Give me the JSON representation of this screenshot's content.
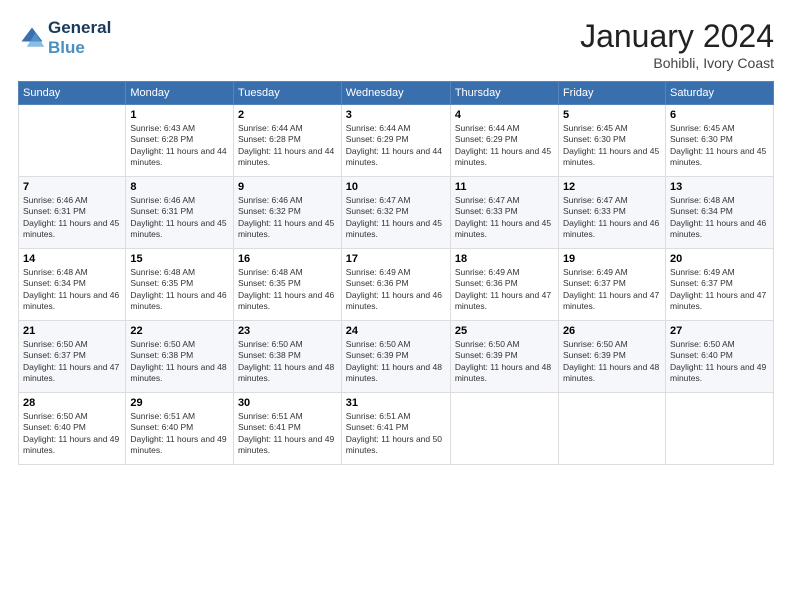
{
  "header": {
    "logo_line1": "General",
    "logo_line2": "Blue",
    "month_title": "January 2024",
    "subtitle": "Bohibli, Ivory Coast"
  },
  "weekdays": [
    "Sunday",
    "Monday",
    "Tuesday",
    "Wednesday",
    "Thursday",
    "Friday",
    "Saturday"
  ],
  "weeks": [
    [
      {
        "day": "",
        "sunrise": "",
        "sunset": "",
        "daylight": ""
      },
      {
        "day": "1",
        "sunrise": "Sunrise: 6:43 AM",
        "sunset": "Sunset: 6:28 PM",
        "daylight": "Daylight: 11 hours and 44 minutes."
      },
      {
        "day": "2",
        "sunrise": "Sunrise: 6:44 AM",
        "sunset": "Sunset: 6:28 PM",
        "daylight": "Daylight: 11 hours and 44 minutes."
      },
      {
        "day": "3",
        "sunrise": "Sunrise: 6:44 AM",
        "sunset": "Sunset: 6:29 PM",
        "daylight": "Daylight: 11 hours and 44 minutes."
      },
      {
        "day": "4",
        "sunrise": "Sunrise: 6:44 AM",
        "sunset": "Sunset: 6:29 PM",
        "daylight": "Daylight: 11 hours and 45 minutes."
      },
      {
        "day": "5",
        "sunrise": "Sunrise: 6:45 AM",
        "sunset": "Sunset: 6:30 PM",
        "daylight": "Daylight: 11 hours and 45 minutes."
      },
      {
        "day": "6",
        "sunrise": "Sunrise: 6:45 AM",
        "sunset": "Sunset: 6:30 PM",
        "daylight": "Daylight: 11 hours and 45 minutes."
      }
    ],
    [
      {
        "day": "7",
        "sunrise": "Sunrise: 6:46 AM",
        "sunset": "Sunset: 6:31 PM",
        "daylight": "Daylight: 11 hours and 45 minutes."
      },
      {
        "day": "8",
        "sunrise": "Sunrise: 6:46 AM",
        "sunset": "Sunset: 6:31 PM",
        "daylight": "Daylight: 11 hours and 45 minutes."
      },
      {
        "day": "9",
        "sunrise": "Sunrise: 6:46 AM",
        "sunset": "Sunset: 6:32 PM",
        "daylight": "Daylight: 11 hours and 45 minutes."
      },
      {
        "day": "10",
        "sunrise": "Sunrise: 6:47 AM",
        "sunset": "Sunset: 6:32 PM",
        "daylight": "Daylight: 11 hours and 45 minutes."
      },
      {
        "day": "11",
        "sunrise": "Sunrise: 6:47 AM",
        "sunset": "Sunset: 6:33 PM",
        "daylight": "Daylight: 11 hours and 45 minutes."
      },
      {
        "day": "12",
        "sunrise": "Sunrise: 6:47 AM",
        "sunset": "Sunset: 6:33 PM",
        "daylight": "Daylight: 11 hours and 46 minutes."
      },
      {
        "day": "13",
        "sunrise": "Sunrise: 6:48 AM",
        "sunset": "Sunset: 6:34 PM",
        "daylight": "Daylight: 11 hours and 46 minutes."
      }
    ],
    [
      {
        "day": "14",
        "sunrise": "Sunrise: 6:48 AM",
        "sunset": "Sunset: 6:34 PM",
        "daylight": "Daylight: 11 hours and 46 minutes."
      },
      {
        "day": "15",
        "sunrise": "Sunrise: 6:48 AM",
        "sunset": "Sunset: 6:35 PM",
        "daylight": "Daylight: 11 hours and 46 minutes."
      },
      {
        "day": "16",
        "sunrise": "Sunrise: 6:48 AM",
        "sunset": "Sunset: 6:35 PM",
        "daylight": "Daylight: 11 hours and 46 minutes."
      },
      {
        "day": "17",
        "sunrise": "Sunrise: 6:49 AM",
        "sunset": "Sunset: 6:36 PM",
        "daylight": "Daylight: 11 hours and 46 minutes."
      },
      {
        "day": "18",
        "sunrise": "Sunrise: 6:49 AM",
        "sunset": "Sunset: 6:36 PM",
        "daylight": "Daylight: 11 hours and 47 minutes."
      },
      {
        "day": "19",
        "sunrise": "Sunrise: 6:49 AM",
        "sunset": "Sunset: 6:37 PM",
        "daylight": "Daylight: 11 hours and 47 minutes."
      },
      {
        "day": "20",
        "sunrise": "Sunrise: 6:49 AM",
        "sunset": "Sunset: 6:37 PM",
        "daylight": "Daylight: 11 hours and 47 minutes."
      }
    ],
    [
      {
        "day": "21",
        "sunrise": "Sunrise: 6:50 AM",
        "sunset": "Sunset: 6:37 PM",
        "daylight": "Daylight: 11 hours and 47 minutes."
      },
      {
        "day": "22",
        "sunrise": "Sunrise: 6:50 AM",
        "sunset": "Sunset: 6:38 PM",
        "daylight": "Daylight: 11 hours and 48 minutes."
      },
      {
        "day": "23",
        "sunrise": "Sunrise: 6:50 AM",
        "sunset": "Sunset: 6:38 PM",
        "daylight": "Daylight: 11 hours and 48 minutes."
      },
      {
        "day": "24",
        "sunrise": "Sunrise: 6:50 AM",
        "sunset": "Sunset: 6:39 PM",
        "daylight": "Daylight: 11 hours and 48 minutes."
      },
      {
        "day": "25",
        "sunrise": "Sunrise: 6:50 AM",
        "sunset": "Sunset: 6:39 PM",
        "daylight": "Daylight: 11 hours and 48 minutes."
      },
      {
        "day": "26",
        "sunrise": "Sunrise: 6:50 AM",
        "sunset": "Sunset: 6:39 PM",
        "daylight": "Daylight: 11 hours and 48 minutes."
      },
      {
        "day": "27",
        "sunrise": "Sunrise: 6:50 AM",
        "sunset": "Sunset: 6:40 PM",
        "daylight": "Daylight: 11 hours and 49 minutes."
      }
    ],
    [
      {
        "day": "28",
        "sunrise": "Sunrise: 6:50 AM",
        "sunset": "Sunset: 6:40 PM",
        "daylight": "Daylight: 11 hours and 49 minutes."
      },
      {
        "day": "29",
        "sunrise": "Sunrise: 6:51 AM",
        "sunset": "Sunset: 6:40 PM",
        "daylight": "Daylight: 11 hours and 49 minutes."
      },
      {
        "day": "30",
        "sunrise": "Sunrise: 6:51 AM",
        "sunset": "Sunset: 6:41 PM",
        "daylight": "Daylight: 11 hours and 49 minutes."
      },
      {
        "day": "31",
        "sunrise": "Sunrise: 6:51 AM",
        "sunset": "Sunset: 6:41 PM",
        "daylight": "Daylight: 11 hours and 50 minutes."
      },
      {
        "day": "",
        "sunrise": "",
        "sunset": "",
        "daylight": ""
      },
      {
        "day": "",
        "sunrise": "",
        "sunset": "",
        "daylight": ""
      },
      {
        "day": "",
        "sunrise": "",
        "sunset": "",
        "daylight": ""
      }
    ]
  ]
}
